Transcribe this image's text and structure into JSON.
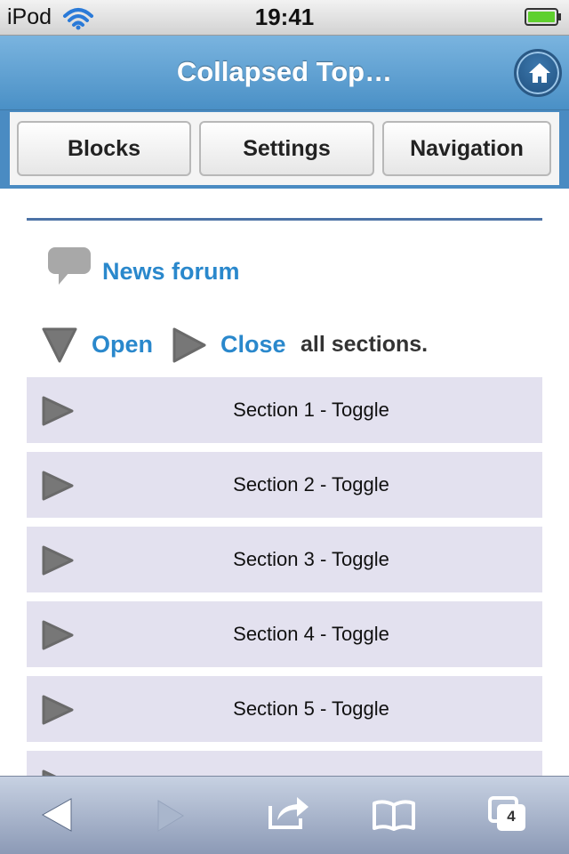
{
  "status_bar": {
    "carrier": "iPod",
    "time": "19:41",
    "icons": [
      "wifi-icon",
      "battery-icon"
    ]
  },
  "header": {
    "title": "Collapsed Top…",
    "home_icon": "home-icon"
  },
  "nav_buttons": [
    {
      "label": "Blocks"
    },
    {
      "label": "Settings"
    },
    {
      "label": "Navigation"
    }
  ],
  "content": {
    "forum_link": "News forum",
    "open_label": "Open",
    "close_label": "Close",
    "all_sections_text": "all sections.",
    "sections": [
      {
        "label": "Section 1 - Toggle"
      },
      {
        "label": "Section 2 - Toggle"
      },
      {
        "label": "Section 3 - Toggle"
      },
      {
        "label": "Section 4 - Toggle"
      },
      {
        "label": "Section 5 - Toggle"
      }
    ]
  },
  "toolbar": {
    "tabs_count": "4",
    "icons": [
      "back-icon",
      "forward-icon",
      "share-icon",
      "bookmarks-icon",
      "tabs-icon"
    ]
  },
  "colors": {
    "header_blue": "#5a9bd0",
    "link_blue": "#2a88cc",
    "section_bg": "#e3e1ef",
    "divider": "#4d73a6"
  }
}
